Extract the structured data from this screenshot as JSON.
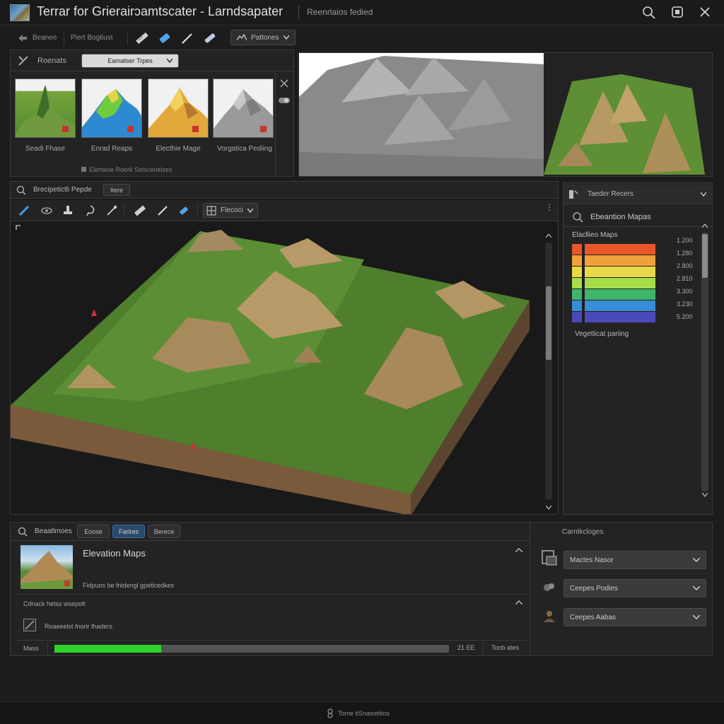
{
  "window": {
    "title": "Terrar for Grierairɔamtscater - Larndsapater",
    "subtitle": "Reenrlaios fedied"
  },
  "toolbar_top": {
    "item1": "Beanee",
    "item2": "Piert Bogtiust",
    "dropdown": "Pattones"
  },
  "presets": {
    "header_label": "Roenats",
    "type_dropdown": "Eamatser Trpes",
    "thumbs": [
      {
        "label": "Seadi Fhase"
      },
      {
        "label": "Enrad Reaps"
      },
      {
        "label": "Electhie Mage"
      },
      {
        "label": "Vorgatica Pediing"
      }
    ],
    "footer": "Elertalse Roerk Setscenelses"
  },
  "viewport": {
    "header_label": "Brecipetictli Pepde",
    "tab": "Itere",
    "tool_dropdown": "Flecoci"
  },
  "right_panel": {
    "dropdown": "Taeder Recers",
    "search_label": "Ebeantion Mapas",
    "legend_title": "Elacllieo Maps",
    "legend_values": [
      "1.200",
      "1.280",
      "2.800",
      "2.810",
      "3.300",
      "3.230",
      "5.200"
    ],
    "legend_colors": [
      "#e8562a",
      "#f0a23a",
      "#e9d94a",
      "#a7dc4a",
      "#3db56a",
      "#3a8cd6",
      "#4b49b8"
    ],
    "legend_footer": "Vegetlicat pariing"
  },
  "bottom": {
    "header_label": "Beaatlmoes",
    "tabs": [
      "Eoose",
      "Farlres",
      "Berece"
    ],
    "right_header": "Carntkcloges",
    "card_title": "Elevation Maps",
    "card_desc": "Fidpuos be fnidengl gpeticedkes",
    "section_label": "Cdnack hetss wsepolt",
    "checkbox_label": "Reaeeelst fnorir fhaders",
    "progress_label": "Mass",
    "progress_value_text": "21 EE",
    "progress_fraction": 0.27,
    "progress_right": "Tonb ates",
    "selects": [
      "Mactes Nasor",
      "Ceepes Podies",
      "Ceepes Aabas"
    ]
  },
  "statusbar": {
    "text": "Tome tiSnasotitios"
  },
  "colors": {
    "accent": "#2f8fd8",
    "progress": "#2fd42c",
    "bg": "#1c1c1d"
  }
}
